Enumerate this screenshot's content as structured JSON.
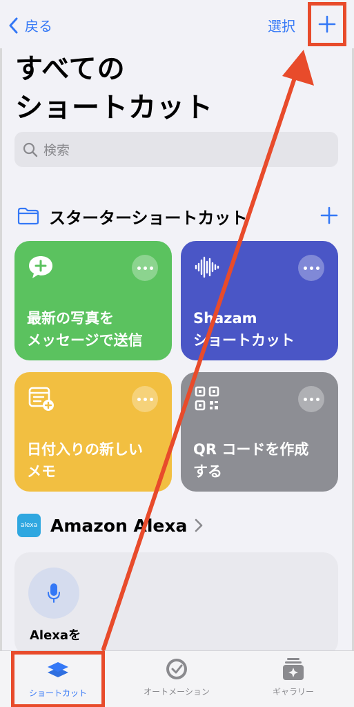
{
  "nav": {
    "back_label": "戻る",
    "select_label": "選択"
  },
  "page": {
    "title_line1": "すべての",
    "title_line2": "ショートカット"
  },
  "search": {
    "placeholder": "検索"
  },
  "starter_section": {
    "title": "スターターショートカット",
    "cards": [
      {
        "label_line1": "最新の写真を",
        "label_line2": "メッセージで送信",
        "color": "#5bc25f",
        "icon": "message-plus-icon"
      },
      {
        "label_line1": "Shazam",
        "label_line2": "ショートカット",
        "color": "#4a56c6",
        "icon": "waveform-icon"
      },
      {
        "label_line1": "日付入りの新しい",
        "label_line2": "メモ",
        "color": "#f2bf41",
        "icon": "note-plus-icon"
      },
      {
        "label_line1": "QR コードを作成",
        "label_line2": "する",
        "color": "#8d8e94",
        "icon": "qr-code-icon"
      }
    ]
  },
  "alexa_section": {
    "logo_text": "alexa",
    "title": "Amazon Alexa",
    "card_label": "Alexaを"
  },
  "tabbar": {
    "tabs": [
      {
        "label": "ショートカット",
        "icon": "layers-icon",
        "selected": true
      },
      {
        "label": "オートメーション",
        "icon": "clock-check-icon",
        "selected": false
      },
      {
        "label": "ギャラリー",
        "icon": "sparkle-stack-icon",
        "selected": false
      }
    ]
  },
  "colors": {
    "accent": "#3478f6",
    "annotation_red": "#e84b2b",
    "background": "#f2f2f7"
  }
}
